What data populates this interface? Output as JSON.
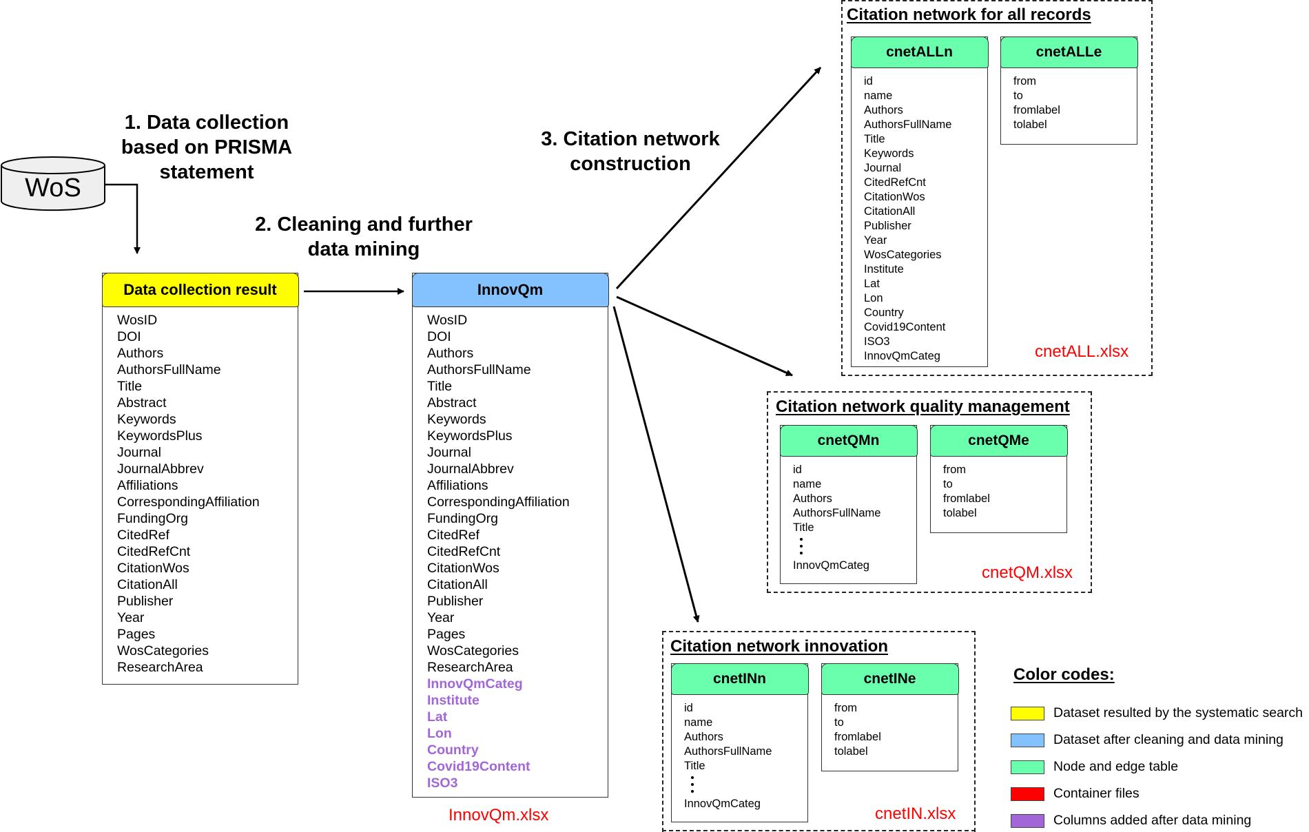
{
  "source": {
    "label": "WoS",
    "icon": "database-cylinder-icon"
  },
  "steps": {
    "step1": "1. Data collection\nbased on PRISMA\nstatement",
    "step2": "2. Cleaning and further\ndata mining",
    "step3": "3. Citation network\nconstruction"
  },
  "colors": {
    "yellow": "#ffff00",
    "blue": "#84c1ff",
    "green": "#6affad",
    "red": "#ff0000",
    "purple": "#a366d9"
  },
  "tables": {
    "data_collection": {
      "title": "Data collection result",
      "columns": [
        "WosID",
        "DOI",
        "Authors",
        "AuthorsFullName",
        "Title",
        "Abstract",
        "Keywords",
        "KeywordsPlus",
        "Journal",
        "JournalAbbrev",
        "Affiliations",
        "CorrespondingAffiliation",
        "FundingOrg",
        "CitedRef",
        "CitedRefCnt",
        "CitationWos",
        "CitationAll",
        "Publisher",
        "Year",
        "Pages",
        "WosCategories",
        "ResearchArea"
      ]
    },
    "innovqm": {
      "title": "InnovQm",
      "columns": [
        "WosID",
        "DOI",
        "Authors",
        "AuthorsFullName",
        "Title",
        "Abstract",
        "Keywords",
        "KeywordsPlus",
        "Journal",
        "JournalAbbrev",
        "Affiliations",
        "CorrespondingAffiliation",
        "FundingOrg",
        "CitedRef",
        "CitedRefCnt",
        "CitationWos",
        "CitationAll",
        "Publisher",
        "Year",
        "Pages",
        "WosCategories",
        "ResearchArea"
      ],
      "added_columns": [
        "InnovQmCateg",
        "Institute",
        "Lat",
        "Lon",
        "Country",
        "Covid19Content",
        "ISO3"
      ],
      "file": "InnovQm.xlsx"
    },
    "cnetALLn": {
      "title": "cnetALLn",
      "columns": [
        "id",
        "name",
        "Authors",
        "AuthorsFullName",
        "Title",
        "Keywords",
        "Journal",
        "CitedRefCnt",
        "CitationWos",
        "CitationAll",
        "Publisher",
        "Year",
        "WosCategories",
        "Institute",
        "Lat",
        "Lon",
        "Country",
        "Covid19Content",
        "ISO3",
        "InnovQmCateg"
      ]
    },
    "cnetALLe": {
      "title": "cnetALLe",
      "columns": [
        "from",
        "to",
        "fromlabel",
        "tolabel"
      ]
    },
    "cnetQMn": {
      "title": "cnetQMn",
      "columns_top": [
        "id",
        "name",
        "Authors",
        "AuthorsFullName",
        "Title"
      ],
      "columns_bottom": [
        "InnovQmCateg"
      ]
    },
    "cnetQMe": {
      "title": "cnetQMe",
      "columns": [
        "from",
        "to",
        "fromlabel",
        "tolabel"
      ]
    },
    "cnetINn": {
      "title": "cnetINn",
      "columns_top": [
        "id",
        "name",
        "Authors",
        "AuthorsFullName",
        "Title"
      ],
      "columns_bottom": [
        "InnovQmCateg"
      ]
    },
    "cnetINe": {
      "title": "cnetINe",
      "columns": [
        "from",
        "to",
        "fromlabel",
        "tolabel"
      ]
    }
  },
  "containers": {
    "all": {
      "title": "Citation network for all records",
      "file": "cnetALL.xlsx"
    },
    "qm": {
      "title": "Citation network quality management",
      "file": "cnetQM.xlsx"
    },
    "in": {
      "title": "Citation network innovation",
      "file": "cnetIN.xlsx"
    }
  },
  "legend": {
    "title": "Color codes:",
    "items": [
      {
        "color": "#ffff00",
        "label": "Dataset resulted by the systematic search"
      },
      {
        "color": "#84c1ff",
        "label": "Dataset after cleaning and data mining"
      },
      {
        "color": "#6affad",
        "label": "Node and edge table"
      },
      {
        "color": "#ff0000",
        "label": "Container files"
      },
      {
        "color": "#a366d9",
        "label": "Columns added after data mining"
      }
    ]
  }
}
